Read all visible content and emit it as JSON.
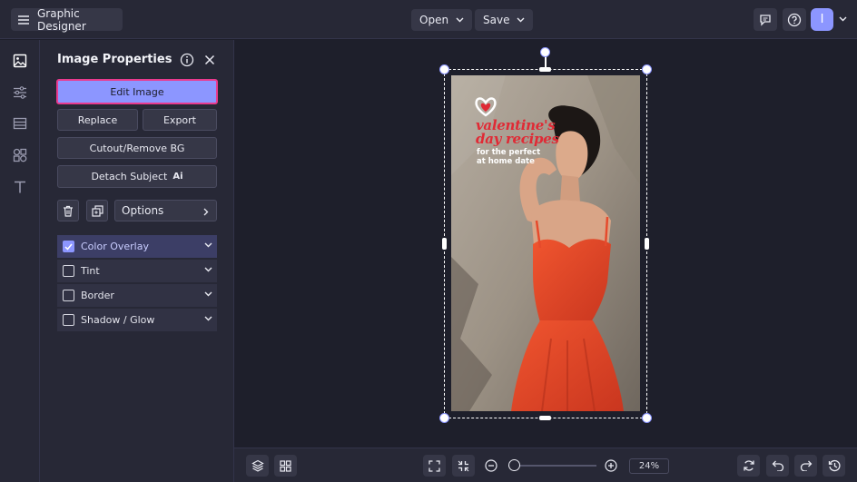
{
  "header": {
    "app_name": "Graphic Designer",
    "open_label": "Open",
    "save_label": "Save",
    "avatar_initial": "I"
  },
  "rail": {
    "items": [
      {
        "icon": "image-icon",
        "active": true
      },
      {
        "icon": "sliders-icon",
        "active": false
      },
      {
        "icon": "layout-icon",
        "active": false
      },
      {
        "icon": "shapes-icon",
        "active": false
      },
      {
        "icon": "text-icon",
        "active": false
      }
    ]
  },
  "panel": {
    "title": "Image Properties",
    "edit_image": "Edit Image",
    "replace": "Replace",
    "export": "Export",
    "cutout": "Cutout/Remove BG",
    "detach": "Detach Subject",
    "ai_badge": "Ai",
    "options": "Options",
    "accordions": [
      {
        "label": "Color Overlay",
        "checked": true
      },
      {
        "label": "Tint",
        "checked": false
      },
      {
        "label": "Border",
        "checked": false
      },
      {
        "label": "Shadow / Glow",
        "checked": false
      }
    ]
  },
  "canvas": {
    "headline_line1": "valentine's",
    "headline_line2": "day recipes",
    "sub_line1": "for the perfect",
    "sub_line2": "at home date"
  },
  "bottom": {
    "zoom_label": "24%",
    "zoom_level": 0.24
  },
  "colors": {
    "accent": "#8c96ff",
    "highlight_border": "#ea3a8e",
    "dress": "#e8472a",
    "headline_red": "#e02a35"
  }
}
